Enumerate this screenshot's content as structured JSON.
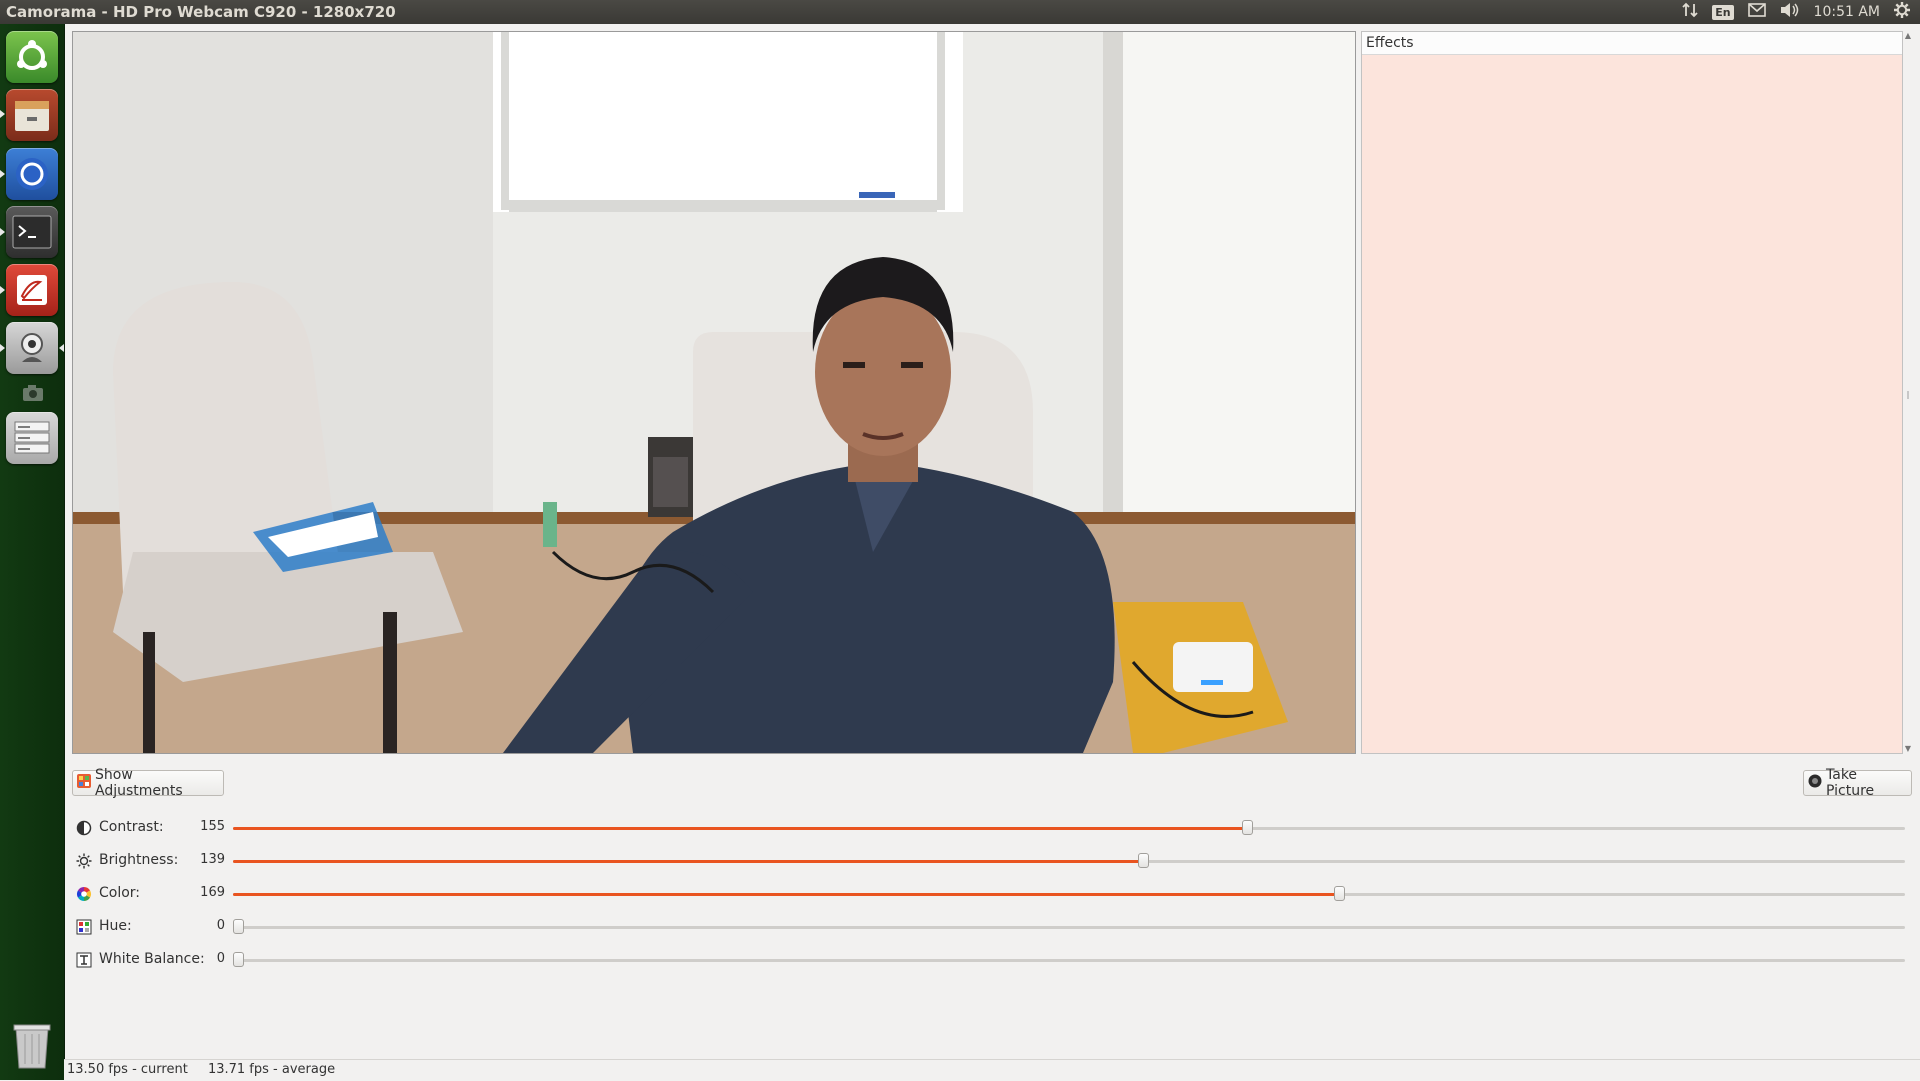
{
  "window": {
    "title": "Camorama - HD Pro Webcam C920 - 1280x720"
  },
  "tray": {
    "network_icon": "updown-arrows-icon",
    "keyboard_lang": "En",
    "mail_icon": "envelope-icon",
    "volume_icon": "speaker-icon",
    "clock": "10:51 AM",
    "settings_icon": "gear-icon"
  },
  "launcher": {
    "items": [
      {
        "name": "dash-home",
        "icon": "ubuntu-logo-icon"
      },
      {
        "name": "files",
        "icon": "file-cabinet-icon"
      },
      {
        "name": "chromium",
        "icon": "browser-icon"
      },
      {
        "name": "terminal",
        "icon": "terminal-icon"
      },
      {
        "name": "text-editor",
        "icon": "pen-icon"
      },
      {
        "name": "camorama",
        "icon": "webcam-icon"
      },
      {
        "name": "small-camera",
        "icon": "camera-icon"
      },
      {
        "name": "storage-devices",
        "icon": "drives-icon"
      },
      {
        "name": "trash",
        "icon": "trash-icon"
      }
    ]
  },
  "effects": {
    "header": "Effects"
  },
  "buttons": {
    "show_adjustments": "Show Adjustments",
    "take_picture": "Take Picture"
  },
  "sliders": [
    {
      "label": "Contrast:",
      "value": "155",
      "fraction": 0.607,
      "icon": "contrast-icon"
    },
    {
      "label": "Brightness:",
      "value": "139",
      "fraction": 0.545,
      "icon": "brightness-icon"
    },
    {
      "label": "Color:",
      "value": "169",
      "fraction": 0.662,
      "icon": "color-wheel-icon"
    },
    {
      "label": "Hue:",
      "value": "0",
      "fraction": 0,
      "icon": "hue-icon"
    },
    {
      "label": "White Balance:",
      "value": "0",
      "fraction": 0,
      "icon": "white-balance-icon"
    }
  ],
  "status": {
    "fps_current": "13.50 fps - current",
    "fps_average": "13.71 fps - average"
  },
  "colors": {
    "accent": "#e95420",
    "effects_bg": "#fce4dc",
    "launcher_bg": "#123a12"
  }
}
